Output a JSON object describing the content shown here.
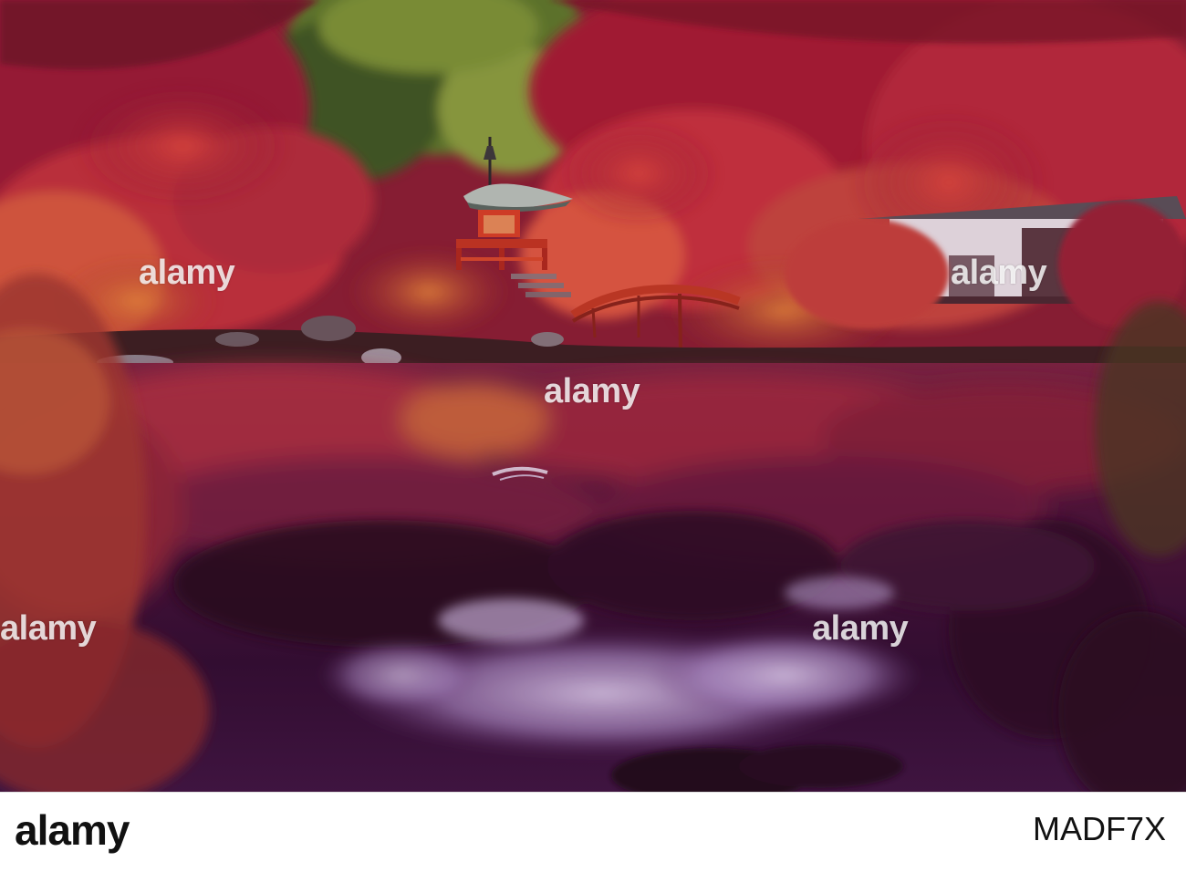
{
  "photo": {
    "subject": "",
    "palette": {
      "sky": "#d9c8e6",
      "foliage_red": "#b8233a",
      "foliage_orange": "#d7682e",
      "foliage_green": "#5c7a2c",
      "pagoda_red": "#c63a22",
      "pagoda_roof": "#c4d0c7",
      "water_dark": "#2b0c2c",
      "water_reflection": "#6b2a55",
      "cloud_reflection": "#c9b7dc"
    }
  },
  "watermarks": [
    "alamy",
    "alamy",
    "alamy",
    "alamy",
    "alamy"
  ],
  "footer": {
    "logo": "alamy",
    "image_id": "MADF7X",
    "background": "#ffffff"
  }
}
